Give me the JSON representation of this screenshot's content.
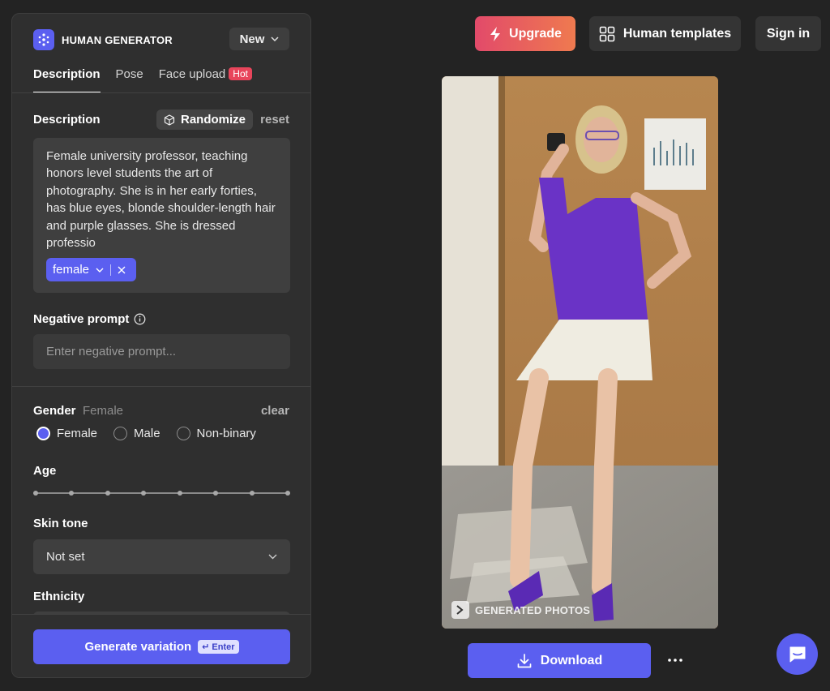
{
  "brand": {
    "name": "HUMAN GENERATOR"
  },
  "header": {
    "new_label": "New"
  },
  "tabs": [
    {
      "label": "Description"
    },
    {
      "label": "Pose"
    },
    {
      "label": "Face upload",
      "badge": "Hot"
    }
  ],
  "description": {
    "title": "Description",
    "randomize_label": "Randomize",
    "reset_label": "reset",
    "text": "Female university professor, teaching honors level students the art of photography. She is in her early forties, has blue eyes, blonde shoulder-length hair and purple glasses. She is dressed professio",
    "tag": "female"
  },
  "negative_prompt": {
    "title": "Negative prompt",
    "placeholder": "Enter negative prompt..."
  },
  "gender": {
    "title": "Gender",
    "value": "Female",
    "clear_label": "clear",
    "options": [
      {
        "label": "Female",
        "checked": true
      },
      {
        "label": "Male",
        "checked": false
      },
      {
        "label": "Non-binary",
        "checked": false
      }
    ]
  },
  "age": {
    "title": "Age"
  },
  "skin_tone": {
    "title": "Skin tone",
    "value": "Not set"
  },
  "ethnicity": {
    "title": "Ethnicity"
  },
  "footer": {
    "generate_label": "Generate variation",
    "shortcut": "↵ Enter"
  },
  "topbar": {
    "upgrade_label": "Upgrade",
    "templates_label": "Human templates",
    "signin_label": "Sign in"
  },
  "image": {
    "watermark": "GENERATED PHOTOS"
  },
  "actions": {
    "download_label": "Download"
  },
  "colors": {
    "accent": "#5b5ff0",
    "hot": "#e8455b",
    "upgrade_start": "#e24a6a",
    "upgrade_end": "#ef7a4f"
  }
}
